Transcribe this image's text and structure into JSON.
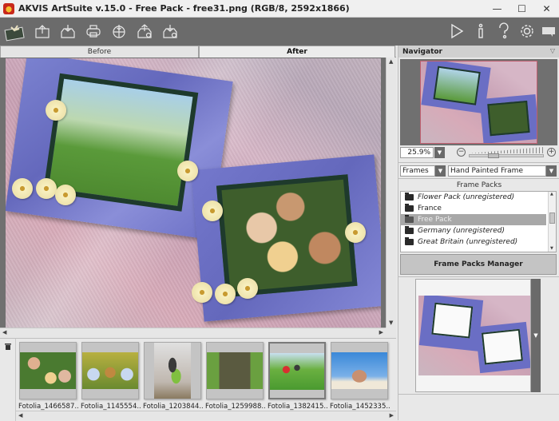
{
  "window": {
    "title": "AKVIS ArtSuite v.15.0 - Free Pack - free31.png (RGB/8, 2592x1866)",
    "controls": [
      "minimize",
      "maximize",
      "close"
    ]
  },
  "toolbar": {
    "left_buttons": [
      {
        "name": "logo",
        "icon": "gift-box-icon"
      },
      {
        "name": "open",
        "icon": "open-file-icon"
      },
      {
        "name": "save",
        "icon": "save-file-icon"
      },
      {
        "name": "print",
        "icon": "print-icon"
      },
      {
        "name": "share",
        "icon": "share-globe-icon"
      },
      {
        "name": "batch-open",
        "icon": "open-settings-icon"
      },
      {
        "name": "batch-save",
        "icon": "save-settings-icon"
      }
    ],
    "right_buttons": [
      {
        "name": "run",
        "icon": "play-icon"
      },
      {
        "name": "info",
        "icon": "info-icon"
      },
      {
        "name": "help",
        "icon": "help-icon"
      },
      {
        "name": "settings",
        "icon": "gear-icon"
      },
      {
        "name": "hints",
        "icon": "comment-icon"
      }
    ]
  },
  "view_tabs": {
    "before": "Before",
    "after": "After",
    "active": "After"
  },
  "filmstrip": {
    "items": [
      {
        "label": "Fotolia_1466587...",
        "selected": false
      },
      {
        "label": "Fotolia_1145554...",
        "selected": false
      },
      {
        "label": "Fotolia_1203844...",
        "selected": false
      },
      {
        "label": "Fotolia_1259988...",
        "selected": false
      },
      {
        "label": "Fotolia_1382415...",
        "selected": true
      },
      {
        "label": "Fotolia_1452335...",
        "selected": false
      }
    ]
  },
  "navigator": {
    "title": "Navigator",
    "zoom_value": "25.9%"
  },
  "effect": {
    "category": "Frames",
    "frame_type": "Hand Painted Frame"
  },
  "frame_packs": {
    "title": "Frame Packs",
    "items": [
      {
        "label": "Flower Pack (unregistered)",
        "italic": true,
        "selected": false
      },
      {
        "label": "France",
        "italic": false,
        "selected": false
      },
      {
        "label": "Free Pack",
        "italic": false,
        "selected": true
      },
      {
        "label": "Germany (unregistered)",
        "italic": true,
        "selected": false
      },
      {
        "label": "Great Britain (unregistered)",
        "italic": true,
        "selected": false
      }
    ],
    "manager_button": "Frame Packs Manager"
  },
  "colors": {
    "toolbar_bg": "#6b6b6b",
    "frame_blue": "#6a6ec4",
    "selection_gray": "#a8a8a8"
  }
}
